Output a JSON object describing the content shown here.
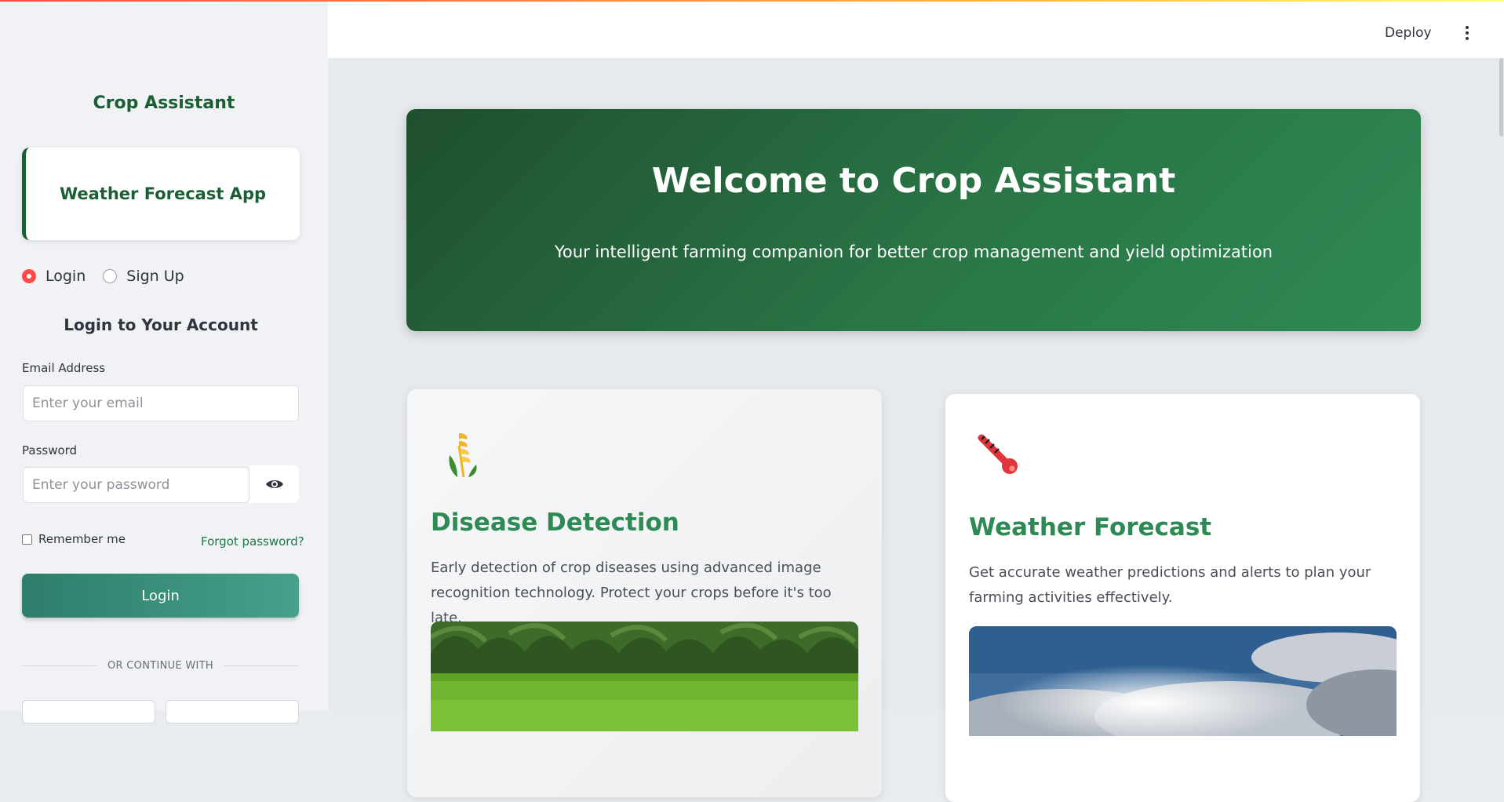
{
  "sidebar": {
    "title": "Crop Assistant",
    "app_card": "Weather Forecast App",
    "auth_modes": [
      {
        "label": "Login",
        "selected": true
      },
      {
        "label": "Sign Up",
        "selected": false
      }
    ],
    "form_heading": "Login to Your Account",
    "email": {
      "label": "Email Address",
      "placeholder": "Enter your email",
      "value": ""
    },
    "password": {
      "label": "Password",
      "placeholder": "Enter your password",
      "value": ""
    },
    "show_password_icon": "eye-icon",
    "remember_me": {
      "label": "Remember me",
      "checked": false
    },
    "forgot_password": "Forgot password?",
    "login_button": "Login",
    "divider_text": "OR CONTINUE WITH"
  },
  "header": {
    "deploy": "Deploy",
    "menu_icon": "vertical-dots-icon"
  },
  "hero": {
    "title": "Welcome to Crop Assistant",
    "subtitle": "Your intelligent farming companion for better crop management and yield optimization"
  },
  "features": [
    {
      "icon": "wheat-icon",
      "title": "Disease Detection",
      "description": "Early detection of crop diseases using advanced image recognition technology. Protect your crops before it's too late."
    },
    {
      "icon": "thermometer-icon",
      "title": "Weather Forecast",
      "description": "Get accurate weather predictions and alerts to plan your farming activities effectively."
    }
  ],
  "colors": {
    "brand_green": "#1b5e34",
    "accent_green": "#2e8a55",
    "radio_active": "#ff4b4b"
  }
}
